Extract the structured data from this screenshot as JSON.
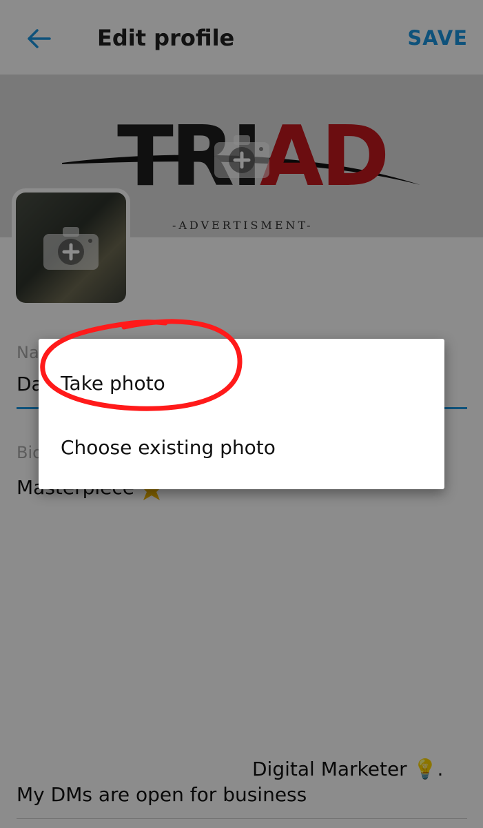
{
  "header": {
    "title": "Edit profile",
    "save_label": "SAVE"
  },
  "banner": {
    "logo_left": "TRI",
    "logo_right": "AD",
    "caption": "-ADVERTISMENT-"
  },
  "form": {
    "name_label": "Name",
    "name_value": "Da",
    "bio_label": "Bio",
    "bio_line1": "Masterpiece",
    "bio_line2": "Digital Marketer 💡.",
    "bio_line3": "My DMs are open for business"
  },
  "dialog": {
    "options": [
      "Take photo",
      "Choose existing photo"
    ]
  },
  "colors": {
    "accent": "#1b95e0",
    "annotation": "#ff1a1a",
    "logo_red": "#c4181e"
  },
  "icons": {
    "back": "arrow-left-icon",
    "camera": "camera-plus-icon"
  }
}
